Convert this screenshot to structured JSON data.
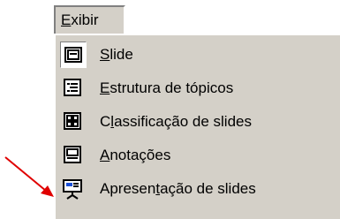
{
  "menu": {
    "title": {
      "mnemonic": "E",
      "rest": "xibir"
    },
    "items": [
      {
        "id": "slide",
        "pre": "",
        "mnemonic": "S",
        "post": "lide",
        "icon": "slide-view-icon",
        "checked": true
      },
      {
        "id": "outline",
        "pre": "",
        "mnemonic": "E",
        "post": "strutura de tópicos",
        "icon": "outline-view-icon",
        "checked": false
      },
      {
        "id": "sorter",
        "pre": "C",
        "mnemonic": "l",
        "post": "assificação de slides",
        "icon": "slide-sorter-icon",
        "checked": false
      },
      {
        "id": "notes",
        "pre": "",
        "mnemonic": "A",
        "post": "notações",
        "icon": "notes-page-icon",
        "checked": false
      },
      {
        "id": "show",
        "pre": "Apresen",
        "mnemonic": "t",
        "post": "ação de slides",
        "icon": "slide-show-icon",
        "checked": false
      }
    ]
  },
  "annotation": {
    "arrow_color": "#e00000"
  },
  "colors": {
    "menu_bg": "#d4d0c8",
    "shadow": "#808080"
  }
}
